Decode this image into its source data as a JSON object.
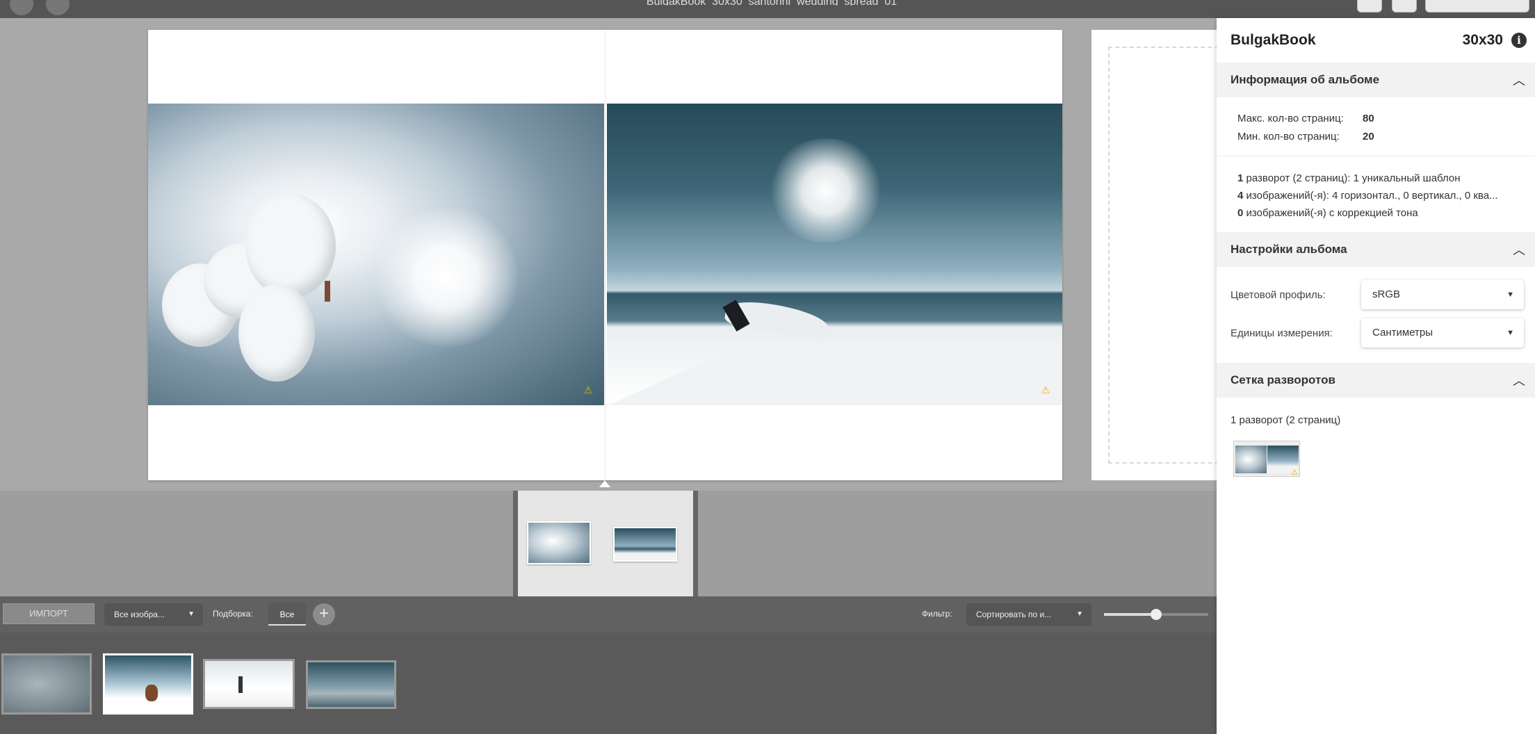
{
  "topbar": {
    "title": "BulgakBook_30x30_santorini_wedding_spread_01"
  },
  "spread": {
    "warning_glyph": "⚠"
  },
  "toolbar": {
    "import_label": "ИМПОРТ",
    "images_dropdown": "Все изобра...",
    "collections_label": "Подборка:",
    "collections_all": "Все",
    "add_glyph": "+",
    "filter_label": "Фильтр:",
    "sort_dropdown": "Сортировать по и...",
    "zoom_level": 0.5
  },
  "panel": {
    "product_name": "BulgakBook",
    "size": "30x30",
    "info_glyph": "i",
    "album_info": {
      "title": "Информация об альбоме",
      "max_pages_label": "Макс. кол-во страниц:",
      "max_pages": "80",
      "min_pages_label": "Мин. кол-во страниц:",
      "min_pages": "20",
      "stats": [
        {
          "count": "1",
          "text": " разворот (2 страниц): 1 уникальный шаблон"
        },
        {
          "count": "4",
          "text": " изображений(-я): 4 горизонтал., 0 вертикал., 0 ква..."
        },
        {
          "count": "0",
          "text": " изображений(-я) с коррекцией тона"
        }
      ]
    },
    "album_settings": {
      "title": "Настройки альбома",
      "color_profile_label": "Цветовой профиль:",
      "color_profile": "sRGB",
      "units_label": "Единицы измерения:",
      "units": "Сантиметры"
    },
    "spread_grid": {
      "title": "Сетка разворотов",
      "summary": "1 разворот (2 страниц)"
    }
  },
  "icons": {
    "chevron": "chevron-up-icon",
    "dropdown": "caret-down-icon",
    "warning": "warning-icon",
    "info": "info-icon"
  },
  "colors": {
    "workspace": "#a9a9a9",
    "toolbar": "#616161",
    "gallery": "#5a5a5a",
    "warning": "#e9b200"
  }
}
